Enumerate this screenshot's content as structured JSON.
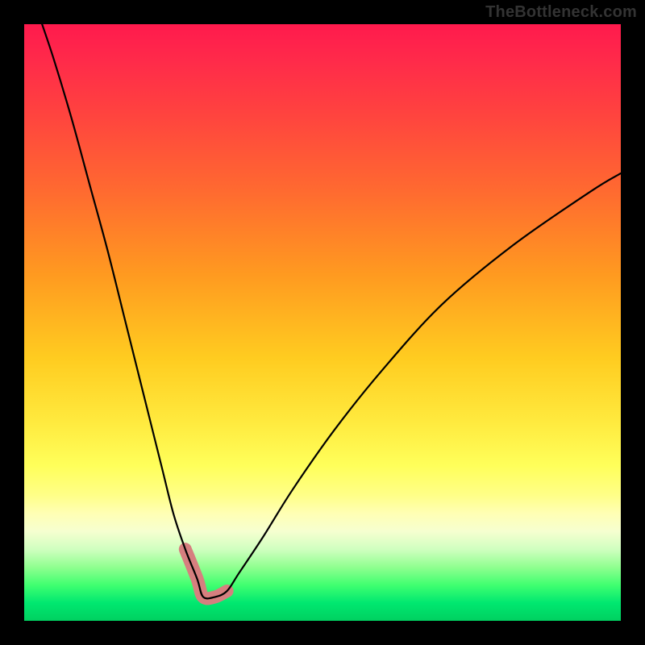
{
  "watermark": "TheBottleneck.com",
  "chart_data": {
    "type": "line",
    "title": "",
    "xlabel": "",
    "ylabel": "",
    "xlim": [
      0,
      100
    ],
    "ylim": [
      0,
      100
    ],
    "grid": false,
    "legend": false,
    "series": [
      {
        "name": "bottleneck-curve",
        "color": "#000000",
        "x": [
          3,
          5,
          8,
          11,
          14,
          17,
          20,
          23,
          25,
          27,
          29,
          30,
          32,
          34,
          36,
          40,
          45,
          52,
          60,
          70,
          82,
          95,
          100
        ],
        "y": [
          100,
          94,
          84,
          73,
          62,
          50,
          38,
          26,
          18,
          12,
          7,
          4,
          4,
          5,
          8,
          14,
          22,
          32,
          42,
          53,
          63,
          72,
          75
        ]
      }
    ],
    "annotations": [
      {
        "name": "optimal-range-marker",
        "type": "range",
        "color": "#d67f7f",
        "x_range": [
          27,
          34
        ],
        "y_range": [
          4,
          12
        ]
      }
    ],
    "gradient_scale": {
      "axis": "y",
      "stops": [
        {
          "value": 100,
          "color": "#ff1a4d",
          "meaning": "severe-bottleneck"
        },
        {
          "value": 70,
          "color": "#ff7a28",
          "meaning": "high-bottleneck"
        },
        {
          "value": 40,
          "color": "#ffe040",
          "meaning": "moderate-bottleneck"
        },
        {
          "value": 15,
          "color": "#ffffa0",
          "meaning": "light-bottleneck"
        },
        {
          "value": 0,
          "color": "#00d060",
          "meaning": "no-bottleneck"
        }
      ]
    }
  }
}
